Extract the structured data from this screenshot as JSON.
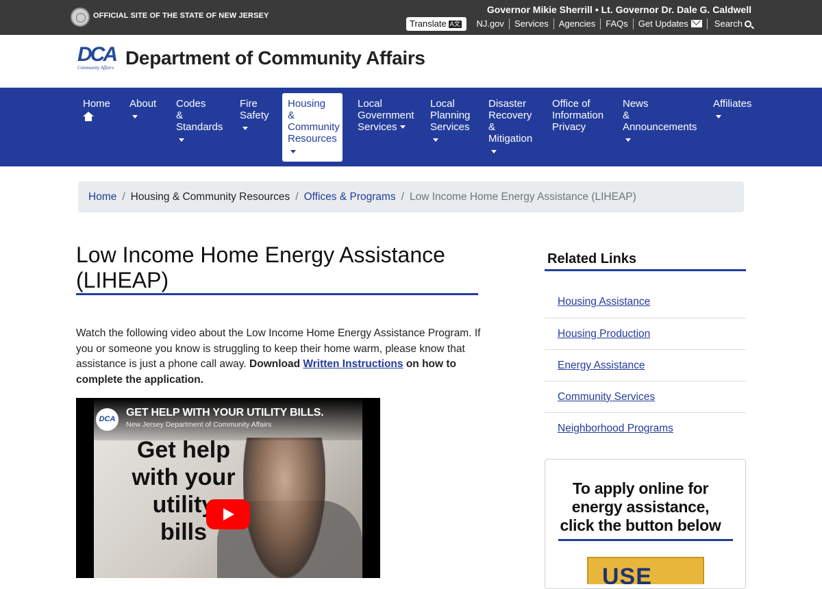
{
  "statebar": {
    "official_text": "OFFICIAL SITE OF THE STATE OF NEW JERSEY",
    "governor_text": "Governor Mikie Sherrill • Lt. Governor Dr. Dale G. Caldwell",
    "translate_label": "Translate",
    "translate_icon_glyph": "A文",
    "links": {
      "njgov": "NJ.gov",
      "services": "Services",
      "agencies": "Agencies",
      "faqs": "FAQs",
      "get_updates": "Get Updates",
      "search": "Search"
    }
  },
  "header": {
    "logo_letters": "DCA",
    "logo_sub": "Community Affairs",
    "department_name": "Department of Community Affairs"
  },
  "nav": {
    "home": "Home",
    "about": "About",
    "codes": [
      "Codes",
      "&",
      "Standards"
    ],
    "fire": [
      "Fire",
      "Safety"
    ],
    "housing": [
      "Housing",
      "&",
      "Community",
      "Resources"
    ],
    "localgov": [
      "Local",
      "Government",
      "Services"
    ],
    "planning": [
      "Local",
      "Planning",
      "Services"
    ],
    "disaster": [
      "Disaster",
      "Recovery",
      "&",
      "Mitigation"
    ],
    "oip": [
      "Office of",
      "Information",
      "Privacy"
    ],
    "news": [
      "News",
      "&",
      "Announcements"
    ],
    "affiliates": "Affiliates"
  },
  "breadcrumb": {
    "home": "Home",
    "housing": "Housing & Community Resources",
    "offices": "Offices & Programs",
    "current": "Low Income Home Energy Assistance (LIHEAP)"
  },
  "main": {
    "title": "Low Income Home Energy Assistance (LIHEAP)",
    "intro_text": "Watch the following video about the Low Income Home Energy Assistance Program. If you or someone you know is struggling to keep their home warm, please know that assistance is just a phone call away.",
    "download_prefix": "Download",
    "download_link": "Written Instructions",
    "download_suffix": "on how to complete the application."
  },
  "video": {
    "channel_logo": "DCA",
    "title": "GET HELP WITH YOUR UTILITY BILLS.",
    "channel": "New Jersey Department of Community Affairs",
    "overlay_lines": [
      "Get help",
      "with your",
      "utility",
      "bills"
    ]
  },
  "sidebar": {
    "title": "Related Links",
    "links": [
      "Housing Assistance",
      "Housing Production",
      "Energy Assistance",
      "Community Services",
      "Neighborhood Programs"
    ],
    "apply_lines": [
      "To apply online for",
      "energy assistance,",
      "click the button below"
    ],
    "apply_button_text": "USE"
  },
  "colors": {
    "nav_blue": "#233c9b",
    "statebar": "#3a3a3a",
    "breadcrumb_bg": "#e9ecef",
    "apply_button": "#e9b63c"
  }
}
